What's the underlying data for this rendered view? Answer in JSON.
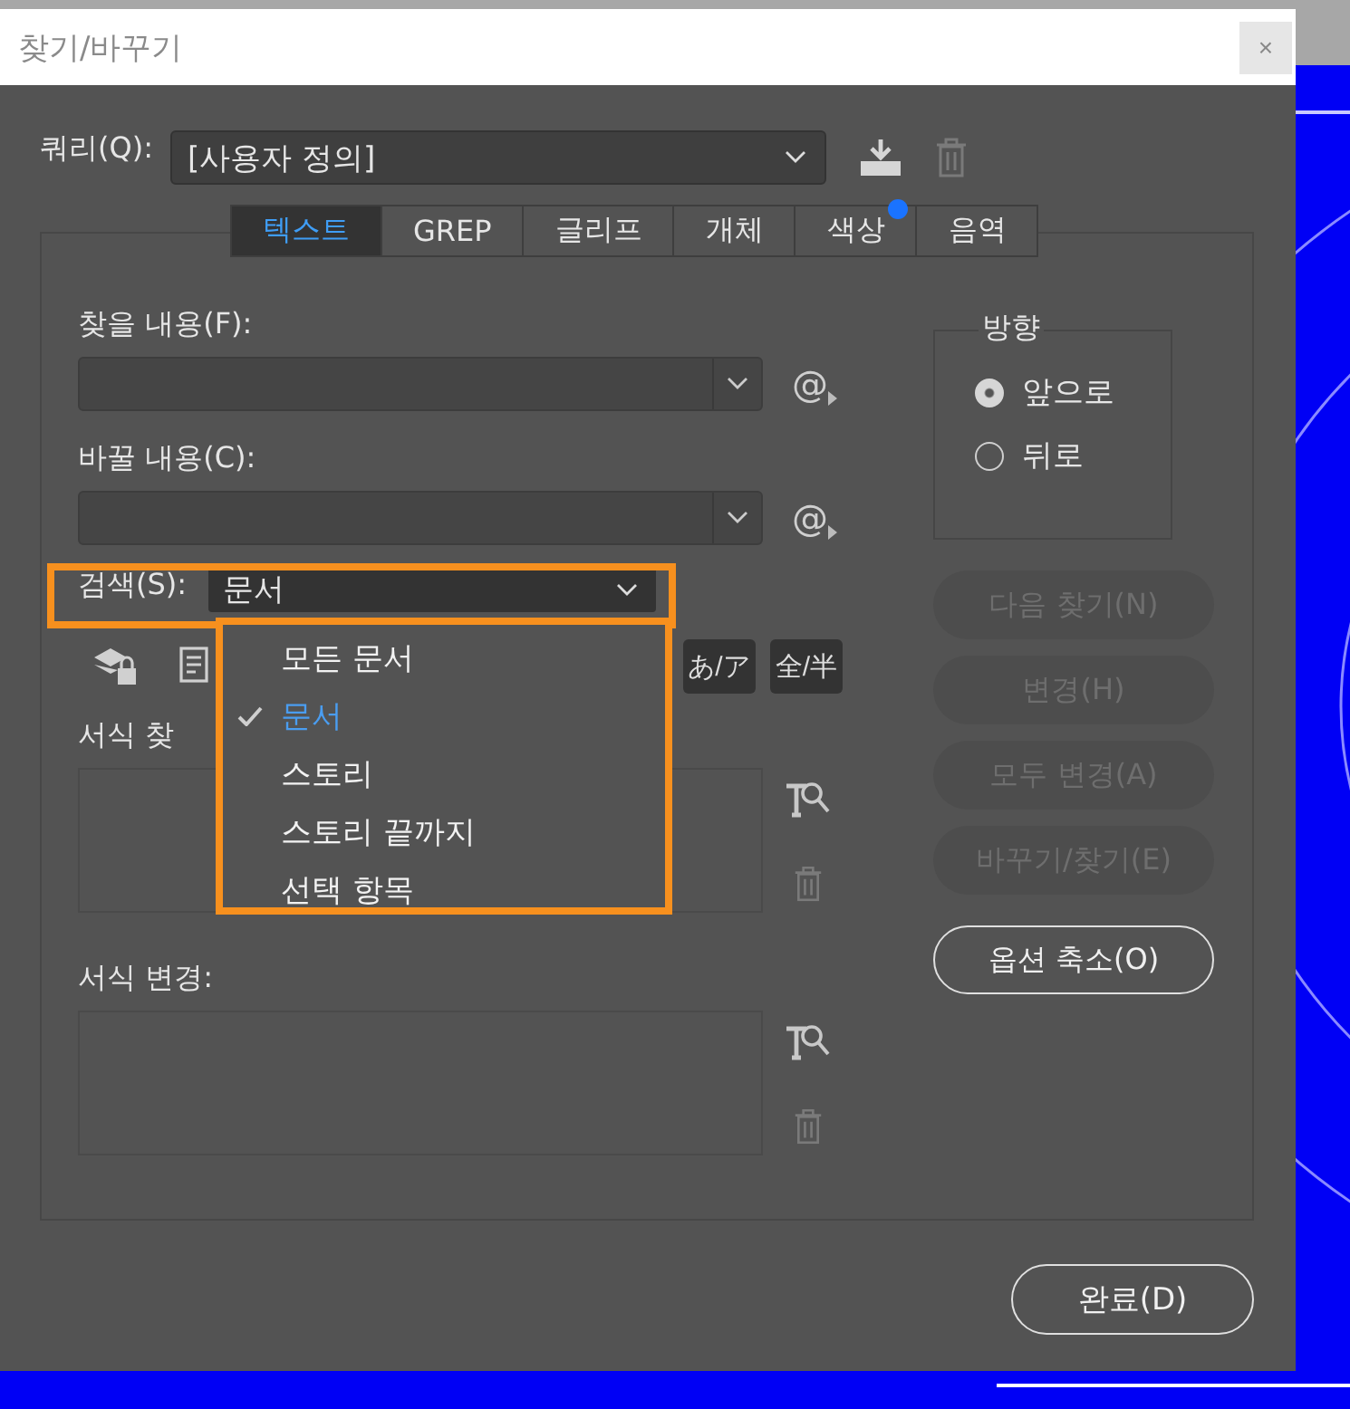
{
  "window": {
    "title": "찾기/바꾸기",
    "close": "×"
  },
  "query": {
    "label": "쿼리(Q):",
    "value": "[사용자 정의]"
  },
  "tabs": [
    {
      "label": "텍스트",
      "selected": true,
      "notification": false
    },
    {
      "label": "GREP",
      "selected": false,
      "notification": false
    },
    {
      "label": "글리프",
      "selected": false,
      "notification": false
    },
    {
      "label": "개체",
      "selected": false,
      "notification": false
    },
    {
      "label": "색상",
      "selected": false,
      "notification": true
    },
    {
      "label": "음역",
      "selected": false,
      "notification": false
    }
  ],
  "find": {
    "label": "찾을 내용(F):",
    "special": "@"
  },
  "change": {
    "label": "바꿀 내용(C):",
    "special": "@"
  },
  "search": {
    "label": "검색(S):",
    "value": "문서",
    "highlighted": true
  },
  "menu": {
    "highlighted": true,
    "items": [
      {
        "label": "모든 문서",
        "selected": false
      },
      {
        "label": "문서",
        "selected": true
      },
      {
        "label": "스토리",
        "selected": false
      },
      {
        "label": "스토리 끝까지",
        "selected": false
      },
      {
        "label": "선택 항목",
        "selected": false
      }
    ]
  },
  "toggles": [
    {
      "label": "あ/ア"
    },
    {
      "label": "全/半"
    }
  ],
  "find_format": {
    "label": "서식 찾"
  },
  "change_format": {
    "label": "서식 변경:"
  },
  "direction": {
    "label": "방향",
    "options": [
      {
        "label": "앞으로",
        "selected": true
      },
      {
        "label": "뒤로",
        "selected": false
      }
    ]
  },
  "actions": [
    {
      "label": "다음 찾기(N)",
      "disabled": true
    },
    {
      "label": "변경(H)",
      "disabled": true
    },
    {
      "label": "모두 변경(A)",
      "disabled": true
    },
    {
      "label": "바꾸기/찾기(E)",
      "disabled": true
    },
    {
      "label": "옵션 축소(O)",
      "disabled": false
    }
  ],
  "done": {
    "label": "완료(D)"
  }
}
